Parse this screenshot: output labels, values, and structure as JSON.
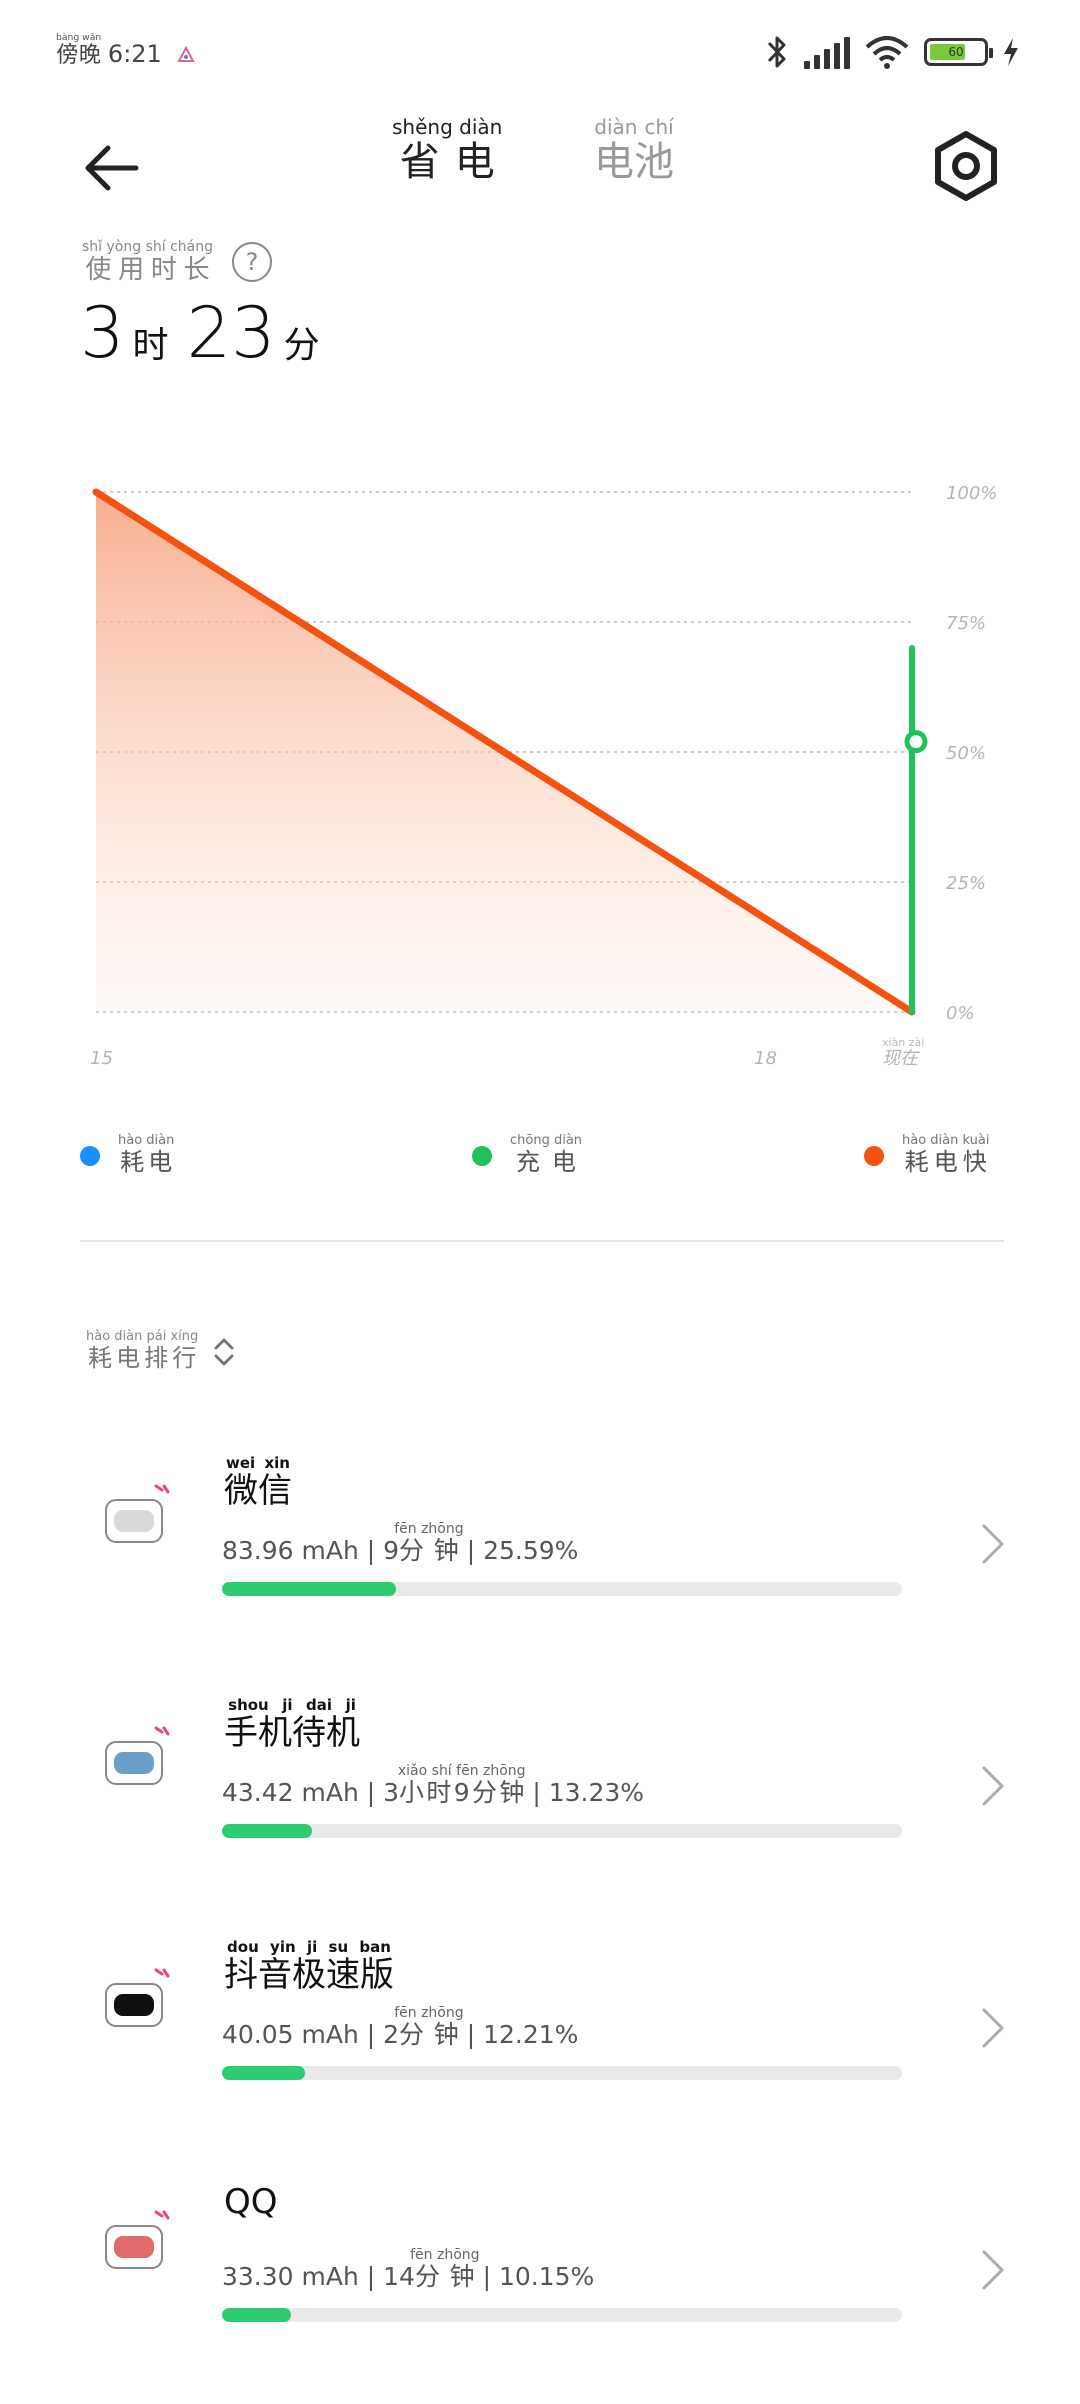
{
  "status_bar": {
    "time_prefix": "傍晚",
    "time_prefix_pinyin": "bàng wǎn",
    "time": "6:21",
    "battery_level": "60",
    "battery_fraction": 0.6,
    "icons": [
      "notification-icon",
      "bluetooth-icon",
      "signal-icon",
      "wifi-icon",
      "battery-icon",
      "charging-icon"
    ]
  },
  "header": {
    "tabs": [
      {
        "label": "省电",
        "pinyin": "shěng diàn",
        "active": true
      },
      {
        "label": "电池",
        "pinyin": "diàn chí",
        "active": false
      }
    ]
  },
  "usage": {
    "label": "使用时长",
    "label_pinyin": "shǐ yòng shí cháng",
    "hours": "3",
    "hour_unit": "时",
    "minutes": "23",
    "minute_unit": "分"
  },
  "chart_data": {
    "type": "line",
    "x_ticks": [
      "15",
      "18",
      "现在"
    ],
    "x_tick_pinyin": [
      "",
      "",
      "xiàn zài"
    ],
    "y_ticks": [
      "100%",
      "75%",
      "50%",
      "25%",
      "0%"
    ],
    "ylim": [
      0,
      100
    ],
    "grid": true,
    "series": [
      {
        "name": "耗电快",
        "color": "#f5520f",
        "points": [
          {
            "t": 14.8,
            "y": 100
          },
          {
            "t": 19.9,
            "y": 0
          }
        ]
      },
      {
        "name": "充电",
        "color": "#1ec15a",
        "points": [
          {
            "t": 19.9,
            "y": 0
          },
          {
            "t": 19.9,
            "y": 70
          }
        ]
      }
    ],
    "x_range": [
      14.8,
      19.9
    ]
  },
  "legend": [
    {
      "label": "耗电",
      "pinyin": "hào diàn",
      "color": "#1890ff"
    },
    {
      "label": "充电",
      "pinyin": "chōng diàn",
      "color": "#1ec15a"
    },
    {
      "label": "耗电快",
      "pinyin": "hào diàn kuài",
      "color": "#f5520f"
    }
  ],
  "ranking": {
    "title": "耗电排行",
    "title_pinyin": "hào diàn pái xíng",
    "apps": [
      {
        "name": "微信",
        "name_pinyin": "wei xin",
        "stat_prefix": "83.96 mAh | 9",
        "stat_unit": "分钟",
        "stat_unit_pinyin": "fēn zhōng",
        "stat_suffix": "| 25.59%",
        "percent": 25.59,
        "icon": "wechat-icon"
      },
      {
        "name": "手机待机",
        "name_pinyin": "shou ji dai ji",
        "stat_prefix": "43.42 mAh | 3",
        "stat_unit": "小时9分钟",
        "stat_unit_pinyin": "xiǎo shí fēn zhōng",
        "stat_suffix": "| 13.23%",
        "percent": 13.23,
        "icon": "standby-icon"
      },
      {
        "name": "抖音极速版",
        "name_pinyin": "dou yin ji su ban",
        "stat_prefix": "40.05 mAh | 2",
        "stat_unit": "分钟",
        "stat_unit_pinyin": "fēn zhōng",
        "stat_suffix": "| 12.21%",
        "percent": 12.21,
        "icon": "douyin-icon"
      },
      {
        "name": "QQ",
        "name_pinyin": "",
        "stat_prefix": "33.30 mAh | 14",
        "stat_unit": "分钟",
        "stat_unit_pinyin": "fēn zhōng",
        "stat_suffix": "| 10.15%",
        "percent": 10.15,
        "icon": "qq-icon"
      }
    ]
  }
}
